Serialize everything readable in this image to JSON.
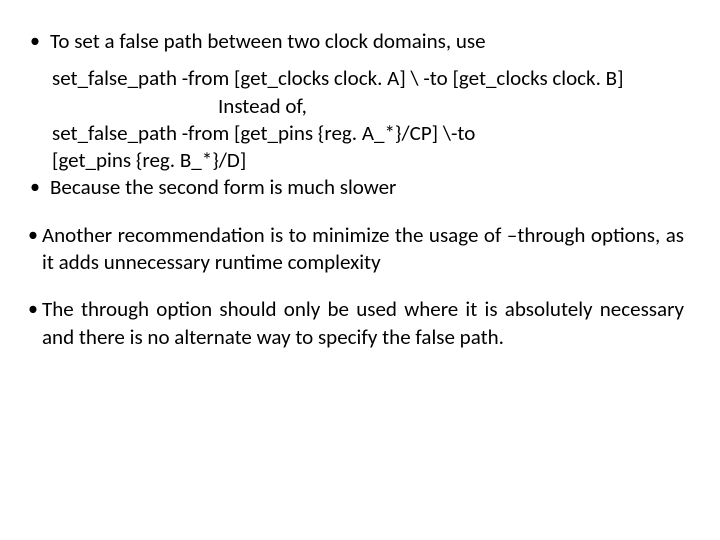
{
  "b1": {
    "text": "To set a false path between two clock domains, use"
  },
  "code": {
    "l1": "set_false_path -from [get_clocks clock. A] \\ -to [get_clocks clock. B]",
    "instead": "Instead of,",
    "l2": "set_false_path -from [get_pins {reg. A_*}/CP] \\-to",
    "l3": "[get_pins {reg. B_*}/D]"
  },
  "b2": {
    "text": "Because the second form is much slower"
  },
  "b3": {
    "text": "Another recommendation is to minimize the usage of –through options, as it adds unnecessary runtime complexity"
  },
  "b4": {
    "text": "The through option should only be used where it is absolutely necessary and there is no alternate way to specify the false path."
  }
}
